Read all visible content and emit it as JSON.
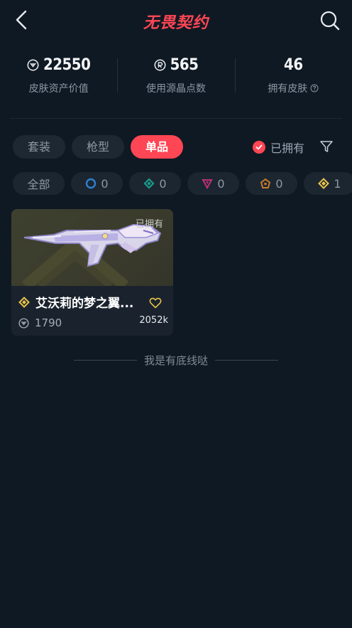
{
  "header": {
    "logo_text": "无畏契约",
    "accent": "#ff4655"
  },
  "stats": [
    {
      "icon": "valorant-points-icon",
      "value": "22550",
      "label": "皮肤资产价值"
    },
    {
      "icon": "radianite-icon",
      "value": "565",
      "label": "使用源晶点数"
    },
    {
      "icon": "",
      "value": "46",
      "label": "拥有皮肤",
      "help_icon": "help-circle-icon"
    }
  ],
  "tabs": [
    {
      "label": "套装",
      "active": false
    },
    {
      "label": "枪型",
      "active": false
    },
    {
      "label": "单品",
      "active": true
    }
  ],
  "owned_filter": {
    "label": "已拥有",
    "checked": true
  },
  "tiers": [
    {
      "label": "全部",
      "icon": "",
      "count": ""
    },
    {
      "icon": "select-tier-icon",
      "count": "0",
      "color": "#2f7fd0"
    },
    {
      "icon": "deluxe-tier-icon",
      "count": "0",
      "color": "#1a9a8c"
    },
    {
      "icon": "premium-tier-icon",
      "count": "0",
      "color": "#c0307a"
    },
    {
      "icon": "exclusive-tier-icon",
      "count": "0",
      "color": "#c77a2a"
    },
    {
      "icon": "ultra-tier-icon",
      "count": "1",
      "color": "#e8c24a"
    }
  ],
  "skin_card": {
    "owned_tag": "已拥有",
    "tier_icon": "ultra-tier-icon",
    "name": "艾沃莉的梦之翼...",
    "price": "1790",
    "likes": "2052k"
  },
  "footer_text": "我是有底线哒"
}
